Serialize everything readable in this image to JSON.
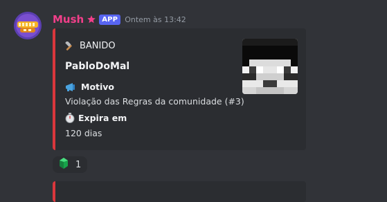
{
  "message": {
    "username": "Mush",
    "badge": "APP",
    "timestamp": "Ontem às 13:42",
    "username_color": "#f23f8a",
    "avatar_icon": "mush-logo-icon"
  },
  "embed": {
    "author_icon": "hammer-icon",
    "author": "BANIDO",
    "title": "PabloDoMal",
    "accent_color": "#da373c",
    "fields": [
      {
        "icon": "megaphone-icon",
        "name": "Motivo",
        "value": "Violação das Regras da comunidade (#3)"
      },
      {
        "icon": "stopwatch-icon",
        "name": "Expira em",
        "value": "120 dias"
      }
    ],
    "thumbnail": "player-skin-head"
  },
  "reaction": {
    "icon": "emerald-icon",
    "count": "1"
  }
}
